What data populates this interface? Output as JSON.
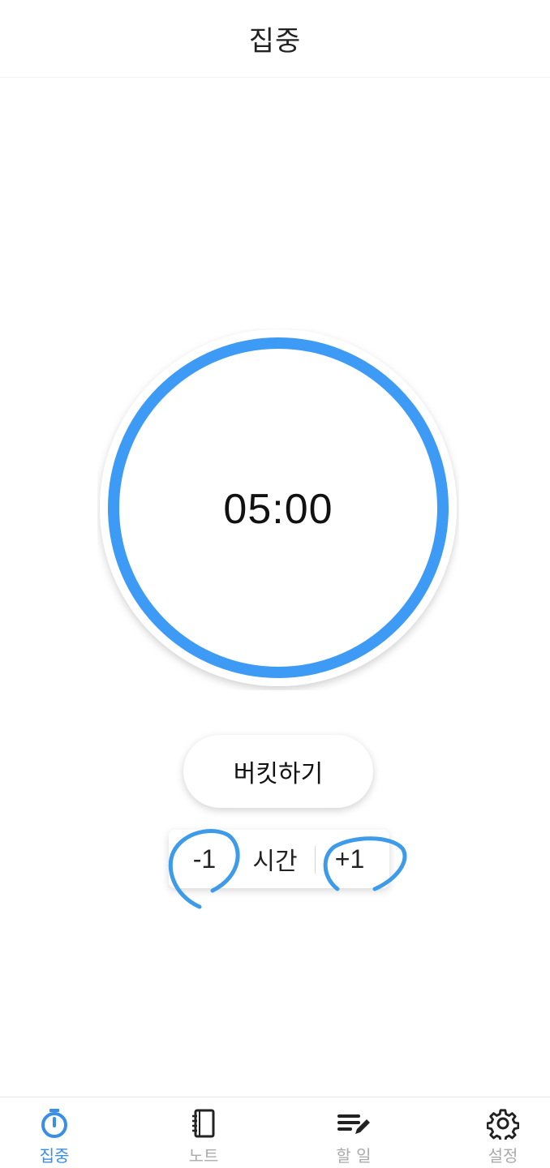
{
  "header": {
    "title": "집중"
  },
  "timer": {
    "display": "05:00",
    "ring_color": "#3d9bf5"
  },
  "actions": {
    "bucket_label": "버킷하기"
  },
  "time_stepper": {
    "minus_label": "-1",
    "label": "시간",
    "plus_label": "+1"
  },
  "annotation": {
    "color": "#3d9be9"
  },
  "tabbar": {
    "active_color": "#3a8ee6",
    "inactive_color": "#aaaaaa",
    "items": [
      {
        "label": "집중",
        "icon": "stopwatch-icon",
        "active": true
      },
      {
        "label": "노트",
        "icon": "notebook-icon",
        "active": false
      },
      {
        "label": "할 일",
        "icon": "edit-list-icon",
        "active": false
      },
      {
        "label": "설정",
        "icon": "gear-icon",
        "active": false
      }
    ]
  }
}
